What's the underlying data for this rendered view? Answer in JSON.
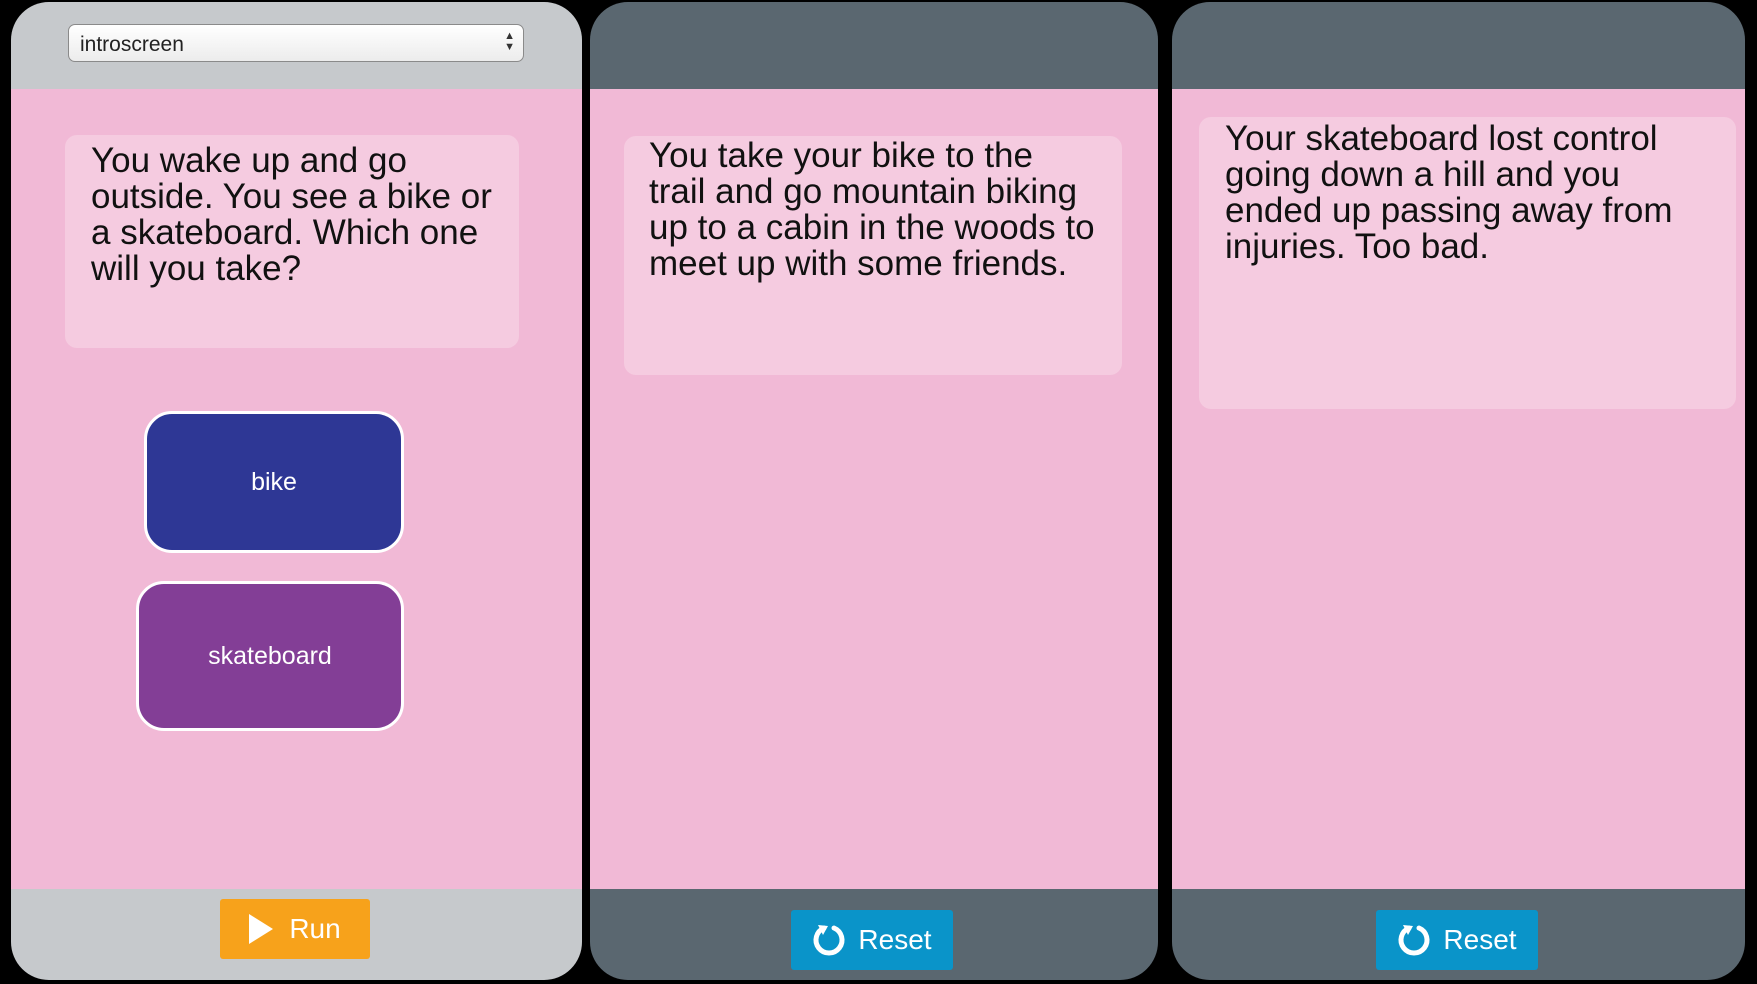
{
  "screen1": {
    "screen_select": {
      "value": "introscreen"
    },
    "text": "You wake up and go outside. You see a bike or a skateboard. Which one will you take?",
    "choices": [
      {
        "label": "bike",
        "color": "#2e3795"
      },
      {
        "label": "skateboard",
        "color": "#833e96"
      }
    ],
    "run_label": "Run"
  },
  "screen2": {
    "text": "You take your bike to the trail and go mountain biking up to a cabin in the woods to meet up with some friends.",
    "reset_label": "Reset"
  },
  "screen3": {
    "text": "Your skateboard lost control going down a hill and you ended up passing away from injuries. Too bad.",
    "reset_label": "Reset"
  },
  "colors": {
    "screen_bg": "#f1b9d6",
    "textbox_bg": "#f5cbe0",
    "run_button": "#f7a21b",
    "reset_button": "#0a94c9",
    "dark_frame": "#5a6770",
    "light_frame": "#c6c9cc"
  },
  "icons": {
    "select_arrows": "up-down-arrows-icon",
    "run": "play-icon",
    "reset": "reset-icon"
  }
}
